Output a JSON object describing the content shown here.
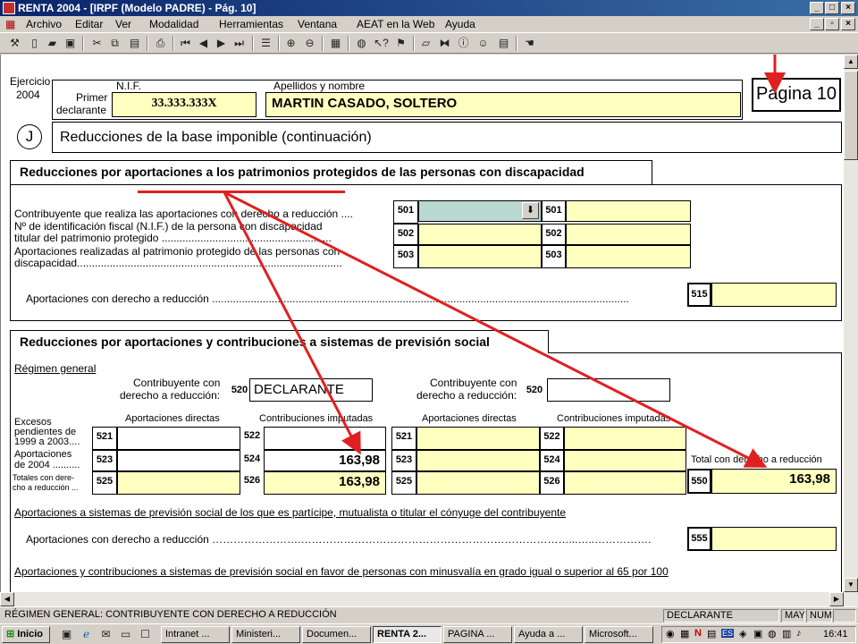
{
  "window": {
    "title": "RENTA 2004 - [IRPF (Modelo PADRE) - Pág. 10]"
  },
  "menu": [
    "Archivo",
    "Editar",
    "Ver",
    "Modalidad",
    "Herramientas",
    "Ventana",
    "AEAT en la Web",
    "Ayuda"
  ],
  "header": {
    "ejercicio_label": "Ejercicio",
    "ejercicio_year": "2004",
    "nif_label": "N.I.F.",
    "apellidos_label": "Apellidos y nombre",
    "primer_label": "Primer",
    "declarante_label": "declarante",
    "nif_value": "33.333.333X",
    "name_value": "MARTIN CASADO, SOLTERO",
    "page_label": "Página 10",
    "section_letter": "J",
    "section_title_bold": "Reducciones de la base imponible",
    "section_title_rest": "(continuación)"
  },
  "patrimonios": {
    "title": "Reducciones por aportaciones a los patrimonios protegidos de las personas con discapacidad",
    "row1": "Contribuyente que realiza las aportaciones con derecho a reducción ....",
    "row2a": "Nº de identificación fiscal (N.I.F.) de la persona con discapacidad",
    "row2b": "titular del patrimonio protegido .........................................................",
    "row3a": "Aportaciones realizadas al patrimonio protegido de las personas con",
    "row3b": "discapacidad.........................................................................................",
    "codes": [
      "501",
      "502",
      "503",
      "501",
      "502",
      "503"
    ],
    "total_label": "Aportaciones con derecho a reducción ............................................................................................................................................",
    "total_code": "515"
  },
  "prevision": {
    "title": "Reducciones por aportaciones y contribuciones a sistemas de previsión social",
    "regimen": "Régimen general",
    "contrib_label1": "Contribuyente con",
    "contrib_label2": "derecho a reducción:",
    "code_520": "520",
    "declarante": "DECLARANTE",
    "col_directas": "Aportaciones directas",
    "col_imputadas": "Contribuciones imputadas",
    "excesos1": "Excesos",
    "excesos2": "pendientes de",
    "excesos3": "1999 a 2003....",
    "aport1": "Aportaciones",
    "aport2": "de 2004 ..........",
    "totales1": "Totales con dere-",
    "totales2": "cho a reducción ...",
    "codes_left": [
      "521",
      "523",
      "525",
      "522",
      "524",
      "526"
    ],
    "codes_right": [
      "521",
      "523",
      "525",
      "522",
      "524",
      "526"
    ],
    "value_524": "163,98",
    "value_526": "163,98",
    "total_reduccion_label": "Total con derecho a reducción",
    "code_550": "550",
    "value_550": "163,98",
    "conyuge_title": "Aportaciones a sistemas de previsión social de los que es partícipe, mutualista o titular el cónyuge del contribuyente",
    "conyuge_row": "Aportaciones con derecho a reducción …………………….…………………………………………………………………...…..…………….",
    "code_555": "555",
    "minusvalia_title": "Aportaciones  y contribuciones a sistemas de previsión social en favor de personas con minusvalía en grado igual o superior al 65 por 100"
  },
  "status": {
    "main": "RÉGIMEN GENERAL: CONTRIBUYENTE CON DERECHO A REDUCCIÓN",
    "declarante": "DECLARANTE",
    "may": "MAY",
    "num": "NUM"
  },
  "taskbar": {
    "start": "Inicio",
    "tasks": [
      "Intranet ...",
      "Ministeri...",
      "Documen...",
      "RENTA 2...",
      "PAGINA ...",
      "Ayuda a ...",
      "Microsoft..."
    ],
    "lang": "ES",
    "clock": "16:41"
  },
  "colors": {
    "annotation": "#e02020",
    "field": "#ffffc0",
    "title_bar": "#0a246a"
  }
}
